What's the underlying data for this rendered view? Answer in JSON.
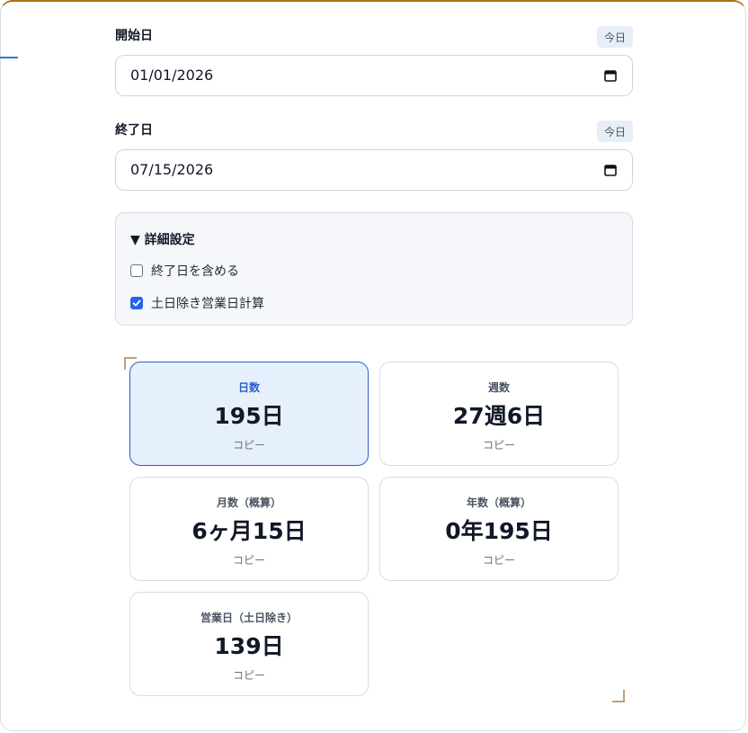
{
  "start": {
    "label": "開始日",
    "today_button": "今日",
    "value": "01/01/2026"
  },
  "end": {
    "label": "終了日",
    "today_button": "今日",
    "value": "07/15/2026"
  },
  "advanced": {
    "summary": "▼ 詳細設定",
    "include_end": {
      "label": "終了日を含める",
      "checked": false
    },
    "business_days": {
      "label": "土日除き営業日計算",
      "checked": true
    }
  },
  "results": [
    {
      "label": "日数",
      "value": "195日",
      "copy": "コピー",
      "active": true
    },
    {
      "label": "週数",
      "value": "27週6日",
      "copy": "コピー",
      "active": false
    },
    {
      "label": "月数（概算）",
      "value": "6ヶ月15日",
      "copy": "コピー",
      "active": false
    },
    {
      "label": "年数（概算）",
      "value": "0年195日",
      "copy": "コピー",
      "active": false
    },
    {
      "label": "営業日（土日除き）",
      "value": "139日",
      "copy": "コピー",
      "active": false
    }
  ],
  "colors": {
    "accent": "#2563eb",
    "active_card_bg": "#e6effc",
    "frame_top": "#a87412"
  },
  "icons": {
    "calendar": "calendar-icon",
    "checkmark": "checkmark-icon"
  }
}
